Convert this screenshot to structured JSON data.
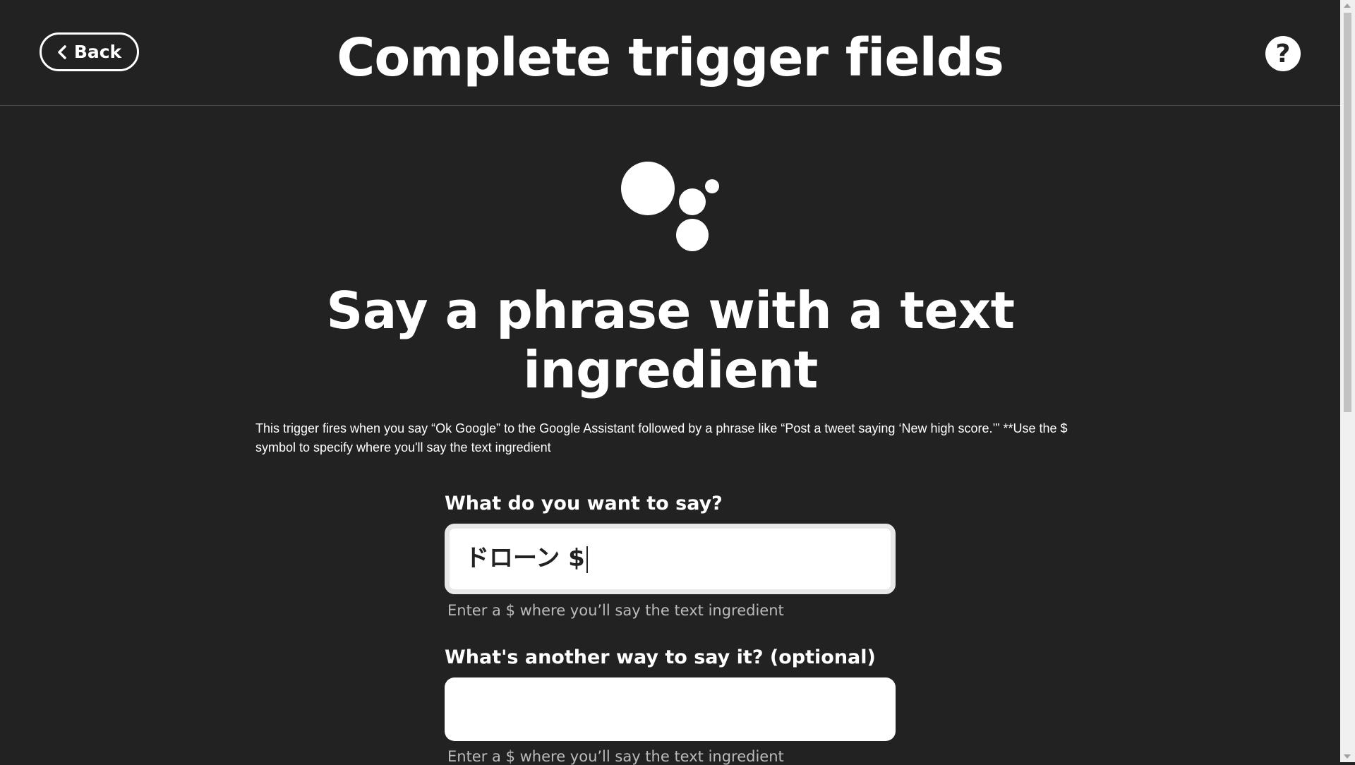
{
  "header": {
    "back_label": "Back",
    "title": "Complete trigger fields",
    "help_label": "?"
  },
  "service": {
    "logo_icon": "google-assistant-icon"
  },
  "trigger": {
    "title": "Say a phrase with a text ingredient",
    "description": "This trigger fires when you say “Ok Google” to the Google Assistant followed by a phrase like “Post a tweet saying ‘New high score.’” **Use the $ symbol to specify where you'll say the text ingredient"
  },
  "fields": [
    {
      "label": "What do you want to say?",
      "value": "ドローン $",
      "helper": "Enter a $ where you’ll say the text ingredient"
    },
    {
      "label": "What's another way to say it? (optional)",
      "value": "",
      "helper": "Enter a $ where you’ll say the text ingredient"
    }
  ],
  "colors": {
    "background": "#222222",
    "text": "#ffffff",
    "input_background": "#ffffff",
    "helper_text": "#bbbbbb"
  }
}
